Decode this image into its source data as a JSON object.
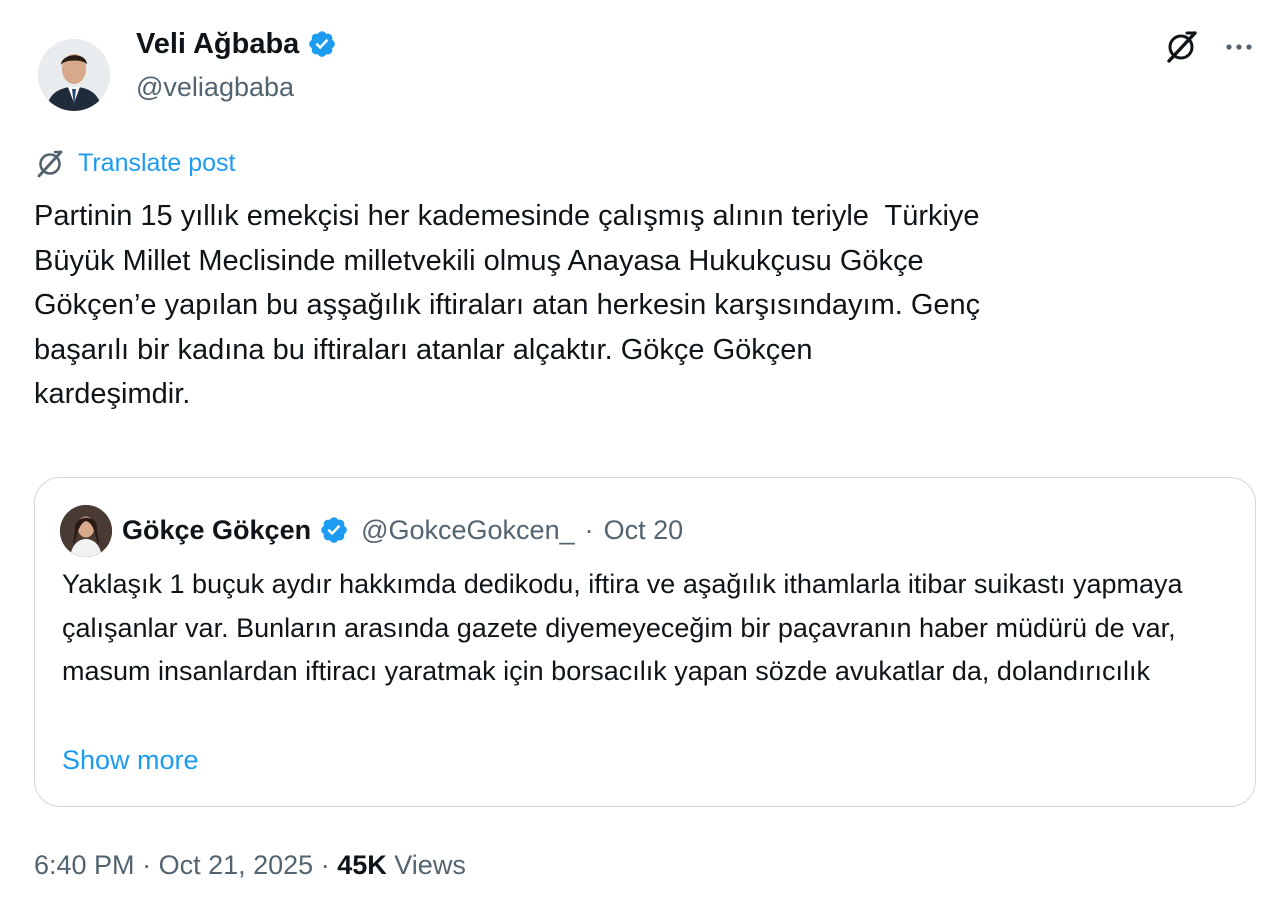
{
  "author": {
    "name": "Veli Ağbaba",
    "handle": "@veliagbaba"
  },
  "translate_label": "Translate post",
  "post_text": "Partinin 15 yıllık emekçisi her kademesinde çalışmış alının teriyle  Türkiye\nBüyük Millet Meclisinde milletvekili olmuş Anayasa Hukukçusu Gökçe\nGökçen’e yapılan bu aşşağılık iftiraları atan herkesin karşısındayım. Genç\nbaşarılı bir kadına bu iftiraları atanlar alçaktır. Gökçe Gökçen\nkardeşimdir.",
  "quote": {
    "name": "Gökçe Gökçen",
    "handle": "@GokceGokcen_",
    "separator": "·",
    "date": "Oct 20",
    "text": "Yaklaşık 1 buçuk aydır hakkımda dedikodu, iftira ve aşağılık ithamlarla itibar suikastı yapmaya çalışanlar var. Bunların arasında gazete diyemeyeceğim bir paçavranın haber müdürü de var, masum insanlardan iftiracı yaratmak için borsacılık yapan sözde avukatlar da, dolandırıcılık",
    "show_more": "Show more"
  },
  "footer": {
    "time": "6:40 PM",
    "separator": "·",
    "date": "Oct 21, 2025",
    "views_count": "45K",
    "views_label": "Views"
  },
  "colors": {
    "accent": "#1d9bf0",
    "secondary_text": "#536471",
    "border": "#cfd9de"
  },
  "icons": [
    "verified-badge-icon",
    "grok-icon",
    "more-options-icon",
    "translate-icon"
  ]
}
